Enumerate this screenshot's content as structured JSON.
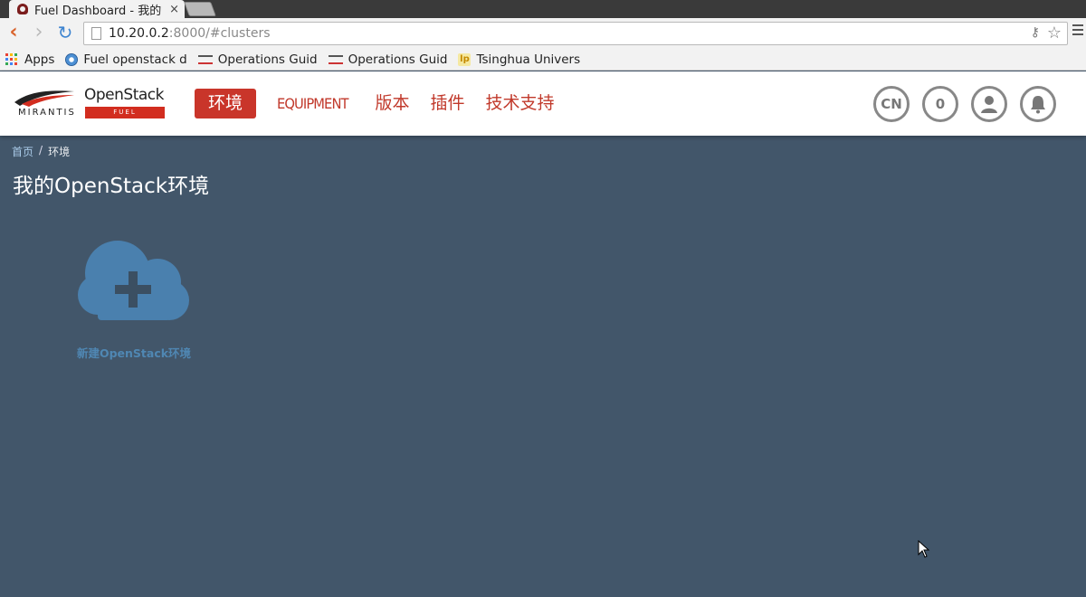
{
  "browser": {
    "tab_title": "Fuel Dashboard - 我的",
    "tab_close": "×",
    "url_host": "10.20.0.2",
    "url_rest": ":8000/#clusters",
    "bookmarks": [
      {
        "label": "Apps"
      },
      {
        "label": "Fuel openstack d"
      },
      {
        "label": "Operations Guid"
      },
      {
        "label": "Operations Guid"
      },
      {
        "label": "Tsinghua Univers"
      }
    ]
  },
  "logo": {
    "brand": "MIRANTIS",
    "product": "OpenStack",
    "sub": "FUEL"
  },
  "nav": {
    "items": [
      {
        "label": "环境",
        "active": true
      },
      {
        "label": "EQUIPMENT",
        "active": false
      },
      {
        "label": "版本",
        "active": false
      },
      {
        "label": "插件",
        "active": false
      },
      {
        "label": "技术支持",
        "active": false
      }
    ]
  },
  "header_buttons": {
    "language": "CN",
    "notifications_count": "0"
  },
  "breadcrumb": {
    "home": "首页",
    "separator": "/",
    "current": "环境"
  },
  "page": {
    "title": "我的OpenStack环境",
    "new_env_label": "新建OpenStack环境"
  },
  "colors": {
    "background": "#42566a",
    "accent": "#c9352a",
    "cloud": "#4a80ae",
    "link": "#a9cae8"
  }
}
